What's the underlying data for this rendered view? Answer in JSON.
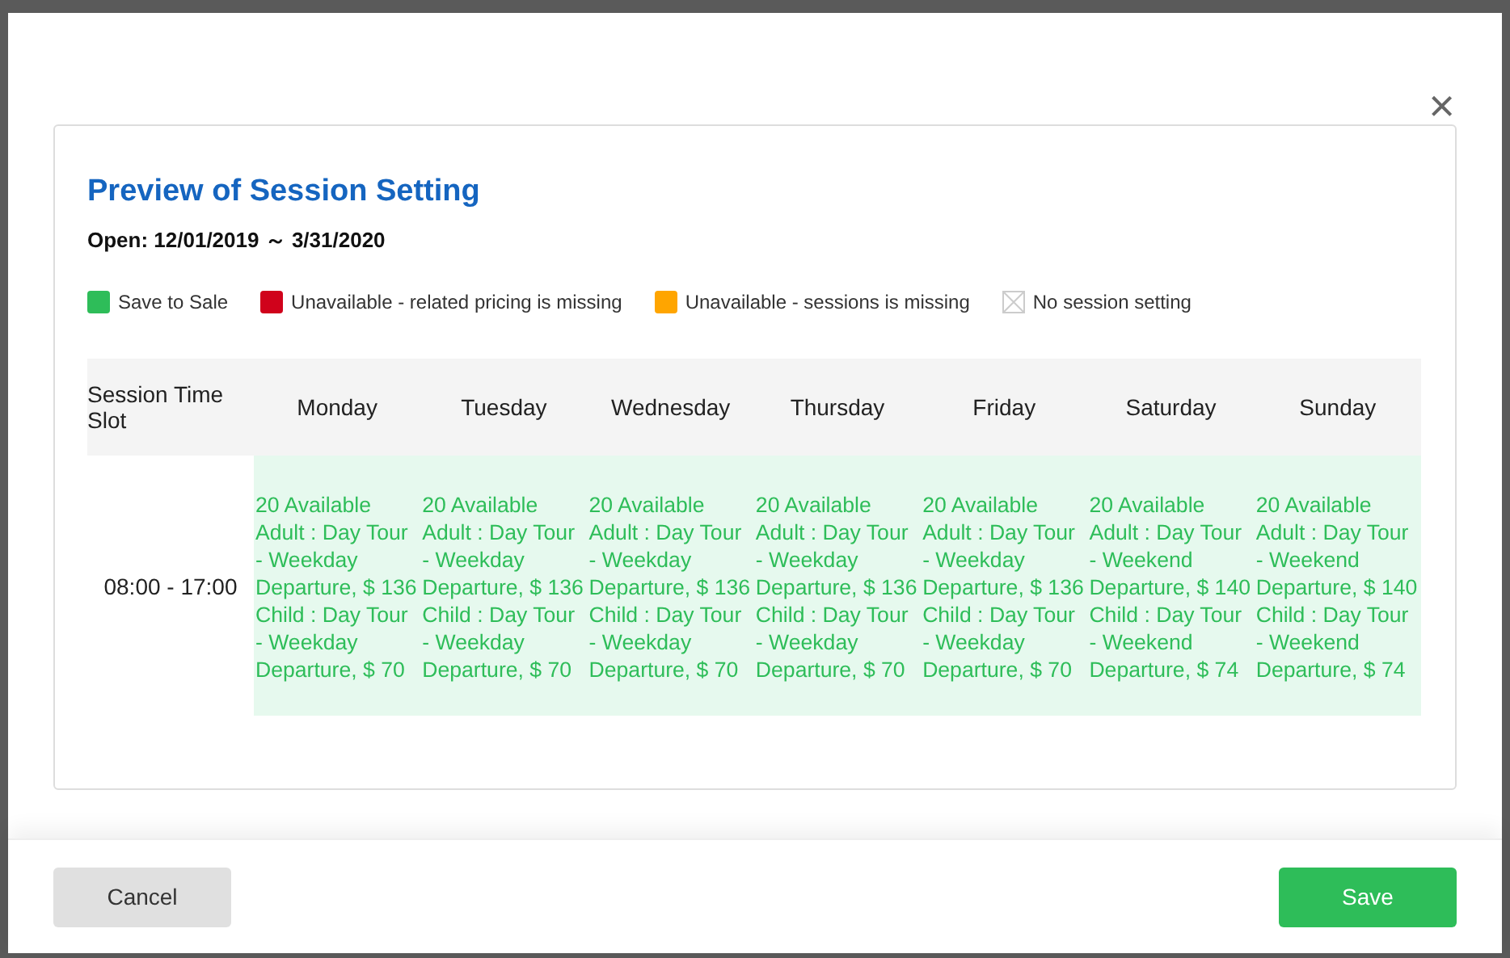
{
  "dialog": {
    "close": "×",
    "title": "Preview of Session Setting",
    "open_range": "Open: 12/01/2019 ～ 3/31/2020",
    "legend": [
      {
        "kind": "swatch",
        "label": "Save to Sale",
        "color": "#2ebd59"
      },
      {
        "kind": "swatch",
        "label": "Unavailable - related pricing is missing",
        "color": "#d0021b"
      },
      {
        "kind": "swatch",
        "label": "Unavailable - sessions is missing",
        "color": "#ffa500"
      },
      {
        "kind": "empty",
        "label": "No session setting"
      }
    ],
    "table": {
      "columns": [
        "Session Time Slot",
        "Monday",
        "Tuesday",
        "Wednesday",
        "Thursday",
        "Friday",
        "Saturday",
        "Sunday"
      ],
      "rows": [
        {
          "cells": [
            {
              "kind": "slot",
              "text": "08:00 - 17:00"
            },
            {
              "kind": "sale",
              "available": "20 Available",
              "prices": [
                "Adult : Day Tour - Weekday Departure, $ 136",
                "Child : Day Tour - Weekday Departure, $ 70"
              ]
            },
            {
              "kind": "sale",
              "available": "20 Available",
              "prices": [
                "Adult : Day Tour - Weekday Departure, $ 136",
                "Child : Day Tour - Weekday Departure, $ 70"
              ]
            },
            {
              "kind": "sale",
              "available": "20 Available",
              "prices": [
                "Adult : Day Tour - Weekday Departure, $ 136",
                "Child : Day Tour - Weekday Departure, $ 70"
              ]
            },
            {
              "kind": "sale",
              "available": "20 Available",
              "prices": [
                "Adult : Day Tour - Weekday Departure, $ 136",
                "Child : Day Tour - Weekday Departure, $ 70"
              ]
            },
            {
              "kind": "sale",
              "available": "20 Available",
              "prices": [
                "Adult : Day Tour - Weekday Departure, $ 136",
                "Child : Day Tour - Weekday Departure, $ 70"
              ]
            },
            {
              "kind": "sale",
              "available": "20 Available",
              "prices": [
                "Adult : Day Tour - Weekend Departure, $ 140",
                "Child : Day Tour - Weekend Departure, $ 74"
              ]
            },
            {
              "kind": "sale",
              "available": "20 Available",
              "prices": [
                "Adult : Day Tour - Weekend Departure, $ 140",
                "Child : Day Tour - Weekend Departure, $ 74"
              ]
            }
          ]
        }
      ]
    },
    "buttons": {
      "cancel": "Cancel",
      "save": "Save"
    }
  }
}
